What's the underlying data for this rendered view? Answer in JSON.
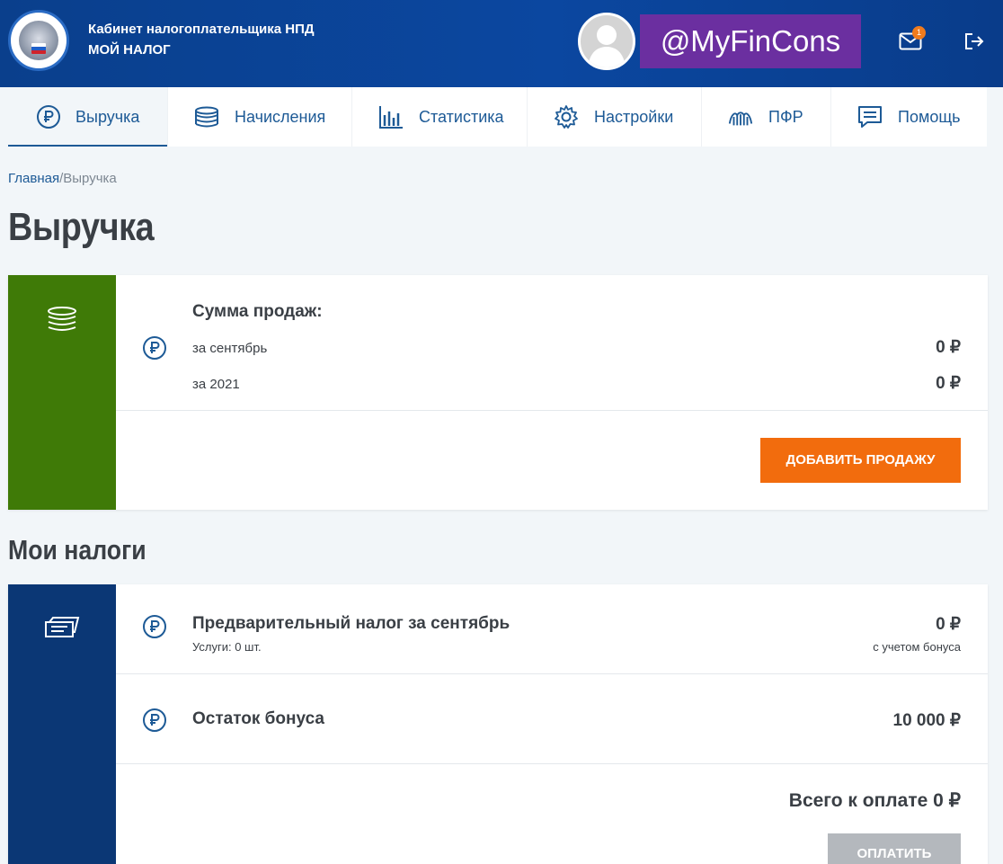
{
  "header": {
    "brand_line1": "Кабинет налогоплательщика НПД",
    "brand_line2": "МОЙ НАЛОГ",
    "watermark": "@MyFinCons",
    "mail_count": "1"
  },
  "tabs": [
    {
      "label": "Выручка",
      "icon": "ruble-circle-icon",
      "active": true
    },
    {
      "label": "Начисления",
      "icon": "coin-stack-icon"
    },
    {
      "label": "Статистика",
      "icon": "bar-chart-icon"
    },
    {
      "label": "Настройки",
      "icon": "gear-icon"
    },
    {
      "label": "ПФР",
      "icon": "pfr-logo-icon"
    },
    {
      "label": "Помощь",
      "icon": "chat-icon"
    }
  ],
  "breadcrumb": {
    "home": "Главная",
    "separator": "/",
    "current": "Выручка"
  },
  "page_title": "Выручка",
  "revenue": {
    "title": "Сумма продаж:",
    "rows": [
      {
        "label": "за сентябрь",
        "value": "0 ₽"
      },
      {
        "label": "за 2021",
        "value": "0 ₽"
      }
    ],
    "add_button": "ДОБАВИТЬ ПРОДАЖУ"
  },
  "taxes_title": "Мои налоги",
  "taxes": {
    "preliminary": {
      "title": "Предварительный налог за сентябрь",
      "sub": "Услуги: 0 шт.",
      "value": "0 ₽",
      "note": "с учетом бонуса"
    },
    "bonus": {
      "title": "Остаток бонуса",
      "value": "10 000 ₽"
    },
    "total": "Всего к оплате 0 ₽",
    "pay_button": "ОПЛАТИТЬ"
  },
  "colors": {
    "header_blue": "#0b47a0",
    "revenue_green": "#3f7a07",
    "taxes_navy": "#0b3775",
    "accent_orange": "#f26c0d",
    "link_blue": "#1d5a96",
    "watermark_purple": "#6b2fa0"
  }
}
